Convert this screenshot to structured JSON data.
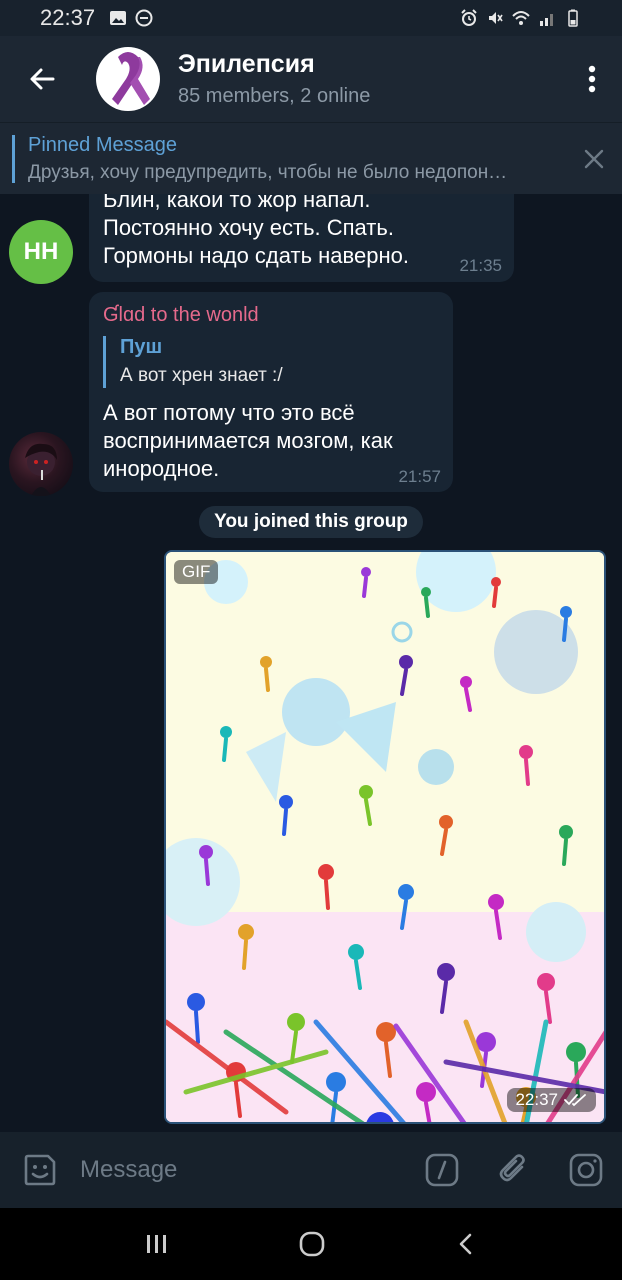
{
  "status_bar": {
    "time": "22:37"
  },
  "header": {
    "back_label": "Back",
    "title": "Эпилепсия",
    "subtitle": "85 members, 2 online"
  },
  "pinned": {
    "title": "Pinned Message",
    "text": "Друзья, хочу предупредить, чтобы не было недопон…"
  },
  "messages": [
    {
      "avatar_initials": "HH",
      "lines": [
        "Блин, какой то жор напал.",
        "Постоянно хочу есть. Спать.",
        "Гормоны надо сдать наверно."
      ],
      "time": "21:35"
    },
    {
      "sender": "Ɠlɑd to the wonld",
      "reply_name": "Пуш",
      "reply_text": "А вот хрен знает :/",
      "lines": [
        "А вот потому что это всё",
        "воспринимается мозгом, как",
        "инородное."
      ],
      "time": "21:57"
    }
  ],
  "service_message": "You joined this group",
  "gif": {
    "badge": "GIF",
    "time": "22:37"
  },
  "input": {
    "placeholder": "Message"
  },
  "colors": {
    "background": "#0e1621",
    "header": "#1d2733",
    "bubble": "#182533",
    "accent": "#5ea1d6",
    "sender_name": "#e56a8c",
    "avatar_hh": "#65bf46"
  }
}
